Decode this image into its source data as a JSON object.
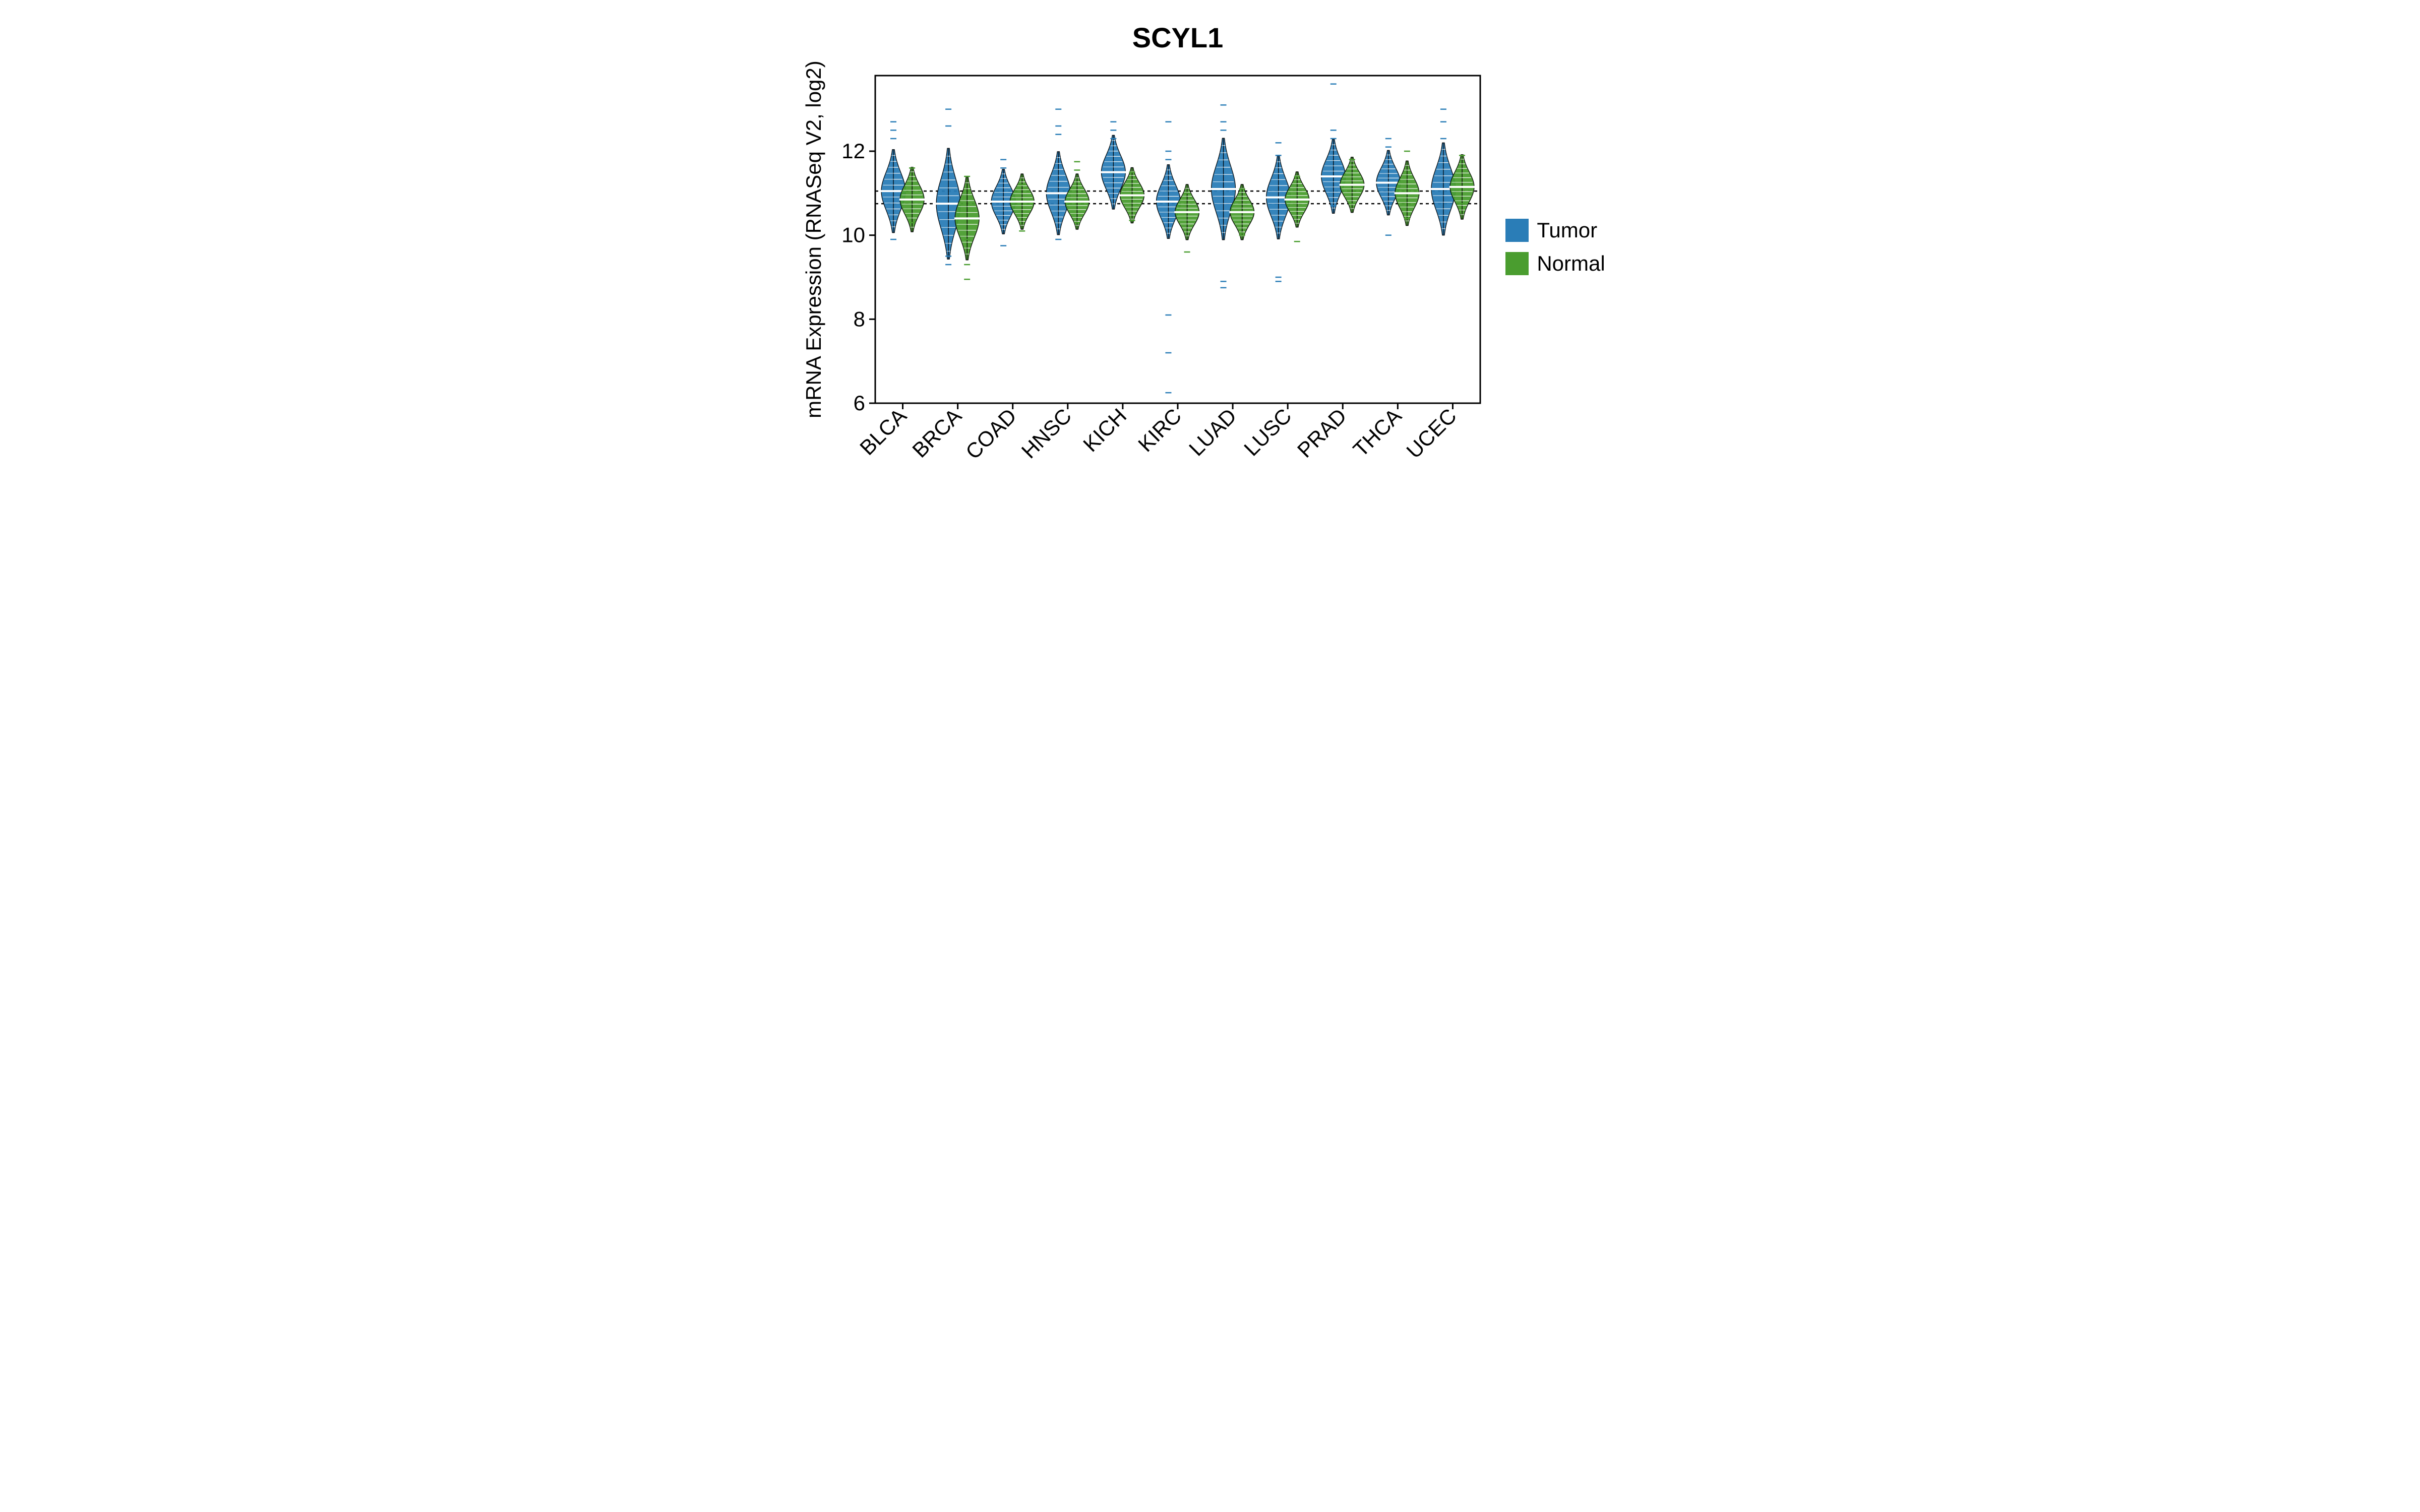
{
  "chart_data": {
    "type": "beanplot",
    "title": "SCYL1",
    "ylabel": "mRNA Expression (RNASeq V2, log2)",
    "xlabel": "",
    "ylim": [
      6,
      13.8
    ],
    "y_ticks": [
      6,
      8,
      10,
      12
    ],
    "categories": [
      "BLCA",
      "BRCA",
      "COAD",
      "HNSC",
      "KICH",
      "KIRC",
      "LUAD",
      "LUSC",
      "PRAD",
      "THCA",
      "UCEC"
    ],
    "reference_lines": [
      11.05,
      10.75
    ],
    "colors": {
      "tumor": "#2a7db7",
      "normal": "#4a9d2f"
    },
    "legend": [
      {
        "name": "Tumor",
        "color": "#2a7db7"
      },
      {
        "name": "Normal",
        "color": "#4a9d2f"
      }
    ],
    "series": [
      {
        "name": "Tumor",
        "color": "#2a7db7",
        "medians": [
          11.05,
          10.75,
          10.8,
          11.0,
          11.5,
          10.8,
          11.1,
          10.9,
          11.4,
          11.25,
          11.1
        ],
        "spreads": [
          0.45,
          0.6,
          0.35,
          0.45,
          0.4,
          0.4,
          0.55,
          0.45,
          0.4,
          0.35,
          0.5
        ],
        "outliers": [
          [
            12.7,
            12.5,
            12.3,
            9.9
          ],
          [
            13.0,
            12.6,
            9.3,
            9.5
          ],
          [
            11.8,
            11.6,
            9.75
          ],
          [
            13.0,
            12.6,
            12.4,
            9.9
          ],
          [
            12.7,
            12.5,
            12.3
          ],
          [
            12.0,
            11.8,
            12.7,
            8.1,
            7.2,
            6.25
          ],
          [
            13.1,
            12.7,
            12.5,
            8.9,
            8.75
          ],
          [
            12.2,
            11.9,
            9.0,
            8.9
          ],
          [
            13.6,
            12.5,
            12.3,
            10.7
          ],
          [
            12.3,
            12.1,
            10.0
          ],
          [
            13.0,
            12.7,
            12.3
          ]
        ]
      },
      {
        "name": "Normal",
        "color": "#4a9d2f",
        "medians": [
          10.85,
          10.4,
          10.8,
          10.8,
          10.95,
          10.55,
          10.55,
          10.85,
          11.2,
          11.0,
          11.15
        ],
        "spreads": [
          0.35,
          0.45,
          0.3,
          0.3,
          0.3,
          0.3,
          0.3,
          0.3,
          0.3,
          0.35,
          0.35
        ],
        "outliers": [
          [
            11.6,
            10.3
          ],
          [
            11.4,
            9.9,
            9.3,
            8.95
          ],
          [
            11.2,
            10.1
          ],
          [
            11.75,
            11.55,
            10.3
          ],
          [
            11.5,
            10.35
          ],
          [
            11.0,
            9.6
          ],
          [
            11.1,
            10.0,
            10.05
          ],
          [
            11.4,
            9.85
          ],
          [
            11.8,
            10.75
          ],
          [
            12.0,
            10.4
          ],
          [
            11.9,
            10.75
          ]
        ]
      }
    ]
  }
}
